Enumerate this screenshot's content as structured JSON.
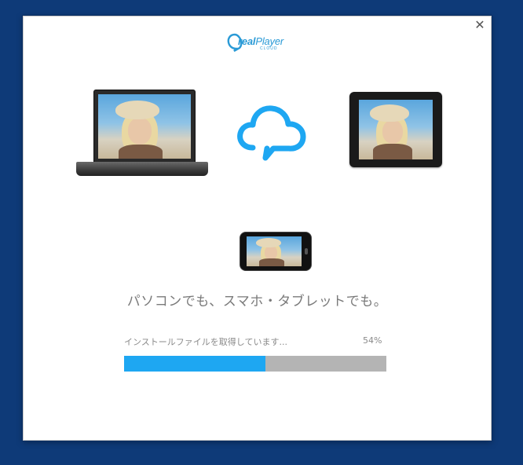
{
  "window": {
    "close_symbol": "✕"
  },
  "logo": {
    "brand_real": "real",
    "brand_player": "Player",
    "brand_sub": "CLOUD",
    "color": "#2a9ad6"
  },
  "illustration": {
    "devices": [
      "laptop",
      "cloud",
      "tablet",
      "phone"
    ],
    "cloud_color": "#1ea7f2"
  },
  "tagline": "パソコンでも、スマホ・タブレットでも。",
  "install": {
    "status": "インストールファイルを取得しています...",
    "percent_label": "54%",
    "progress": 0.54,
    "fill_color": "#1ea7f2",
    "track_color": "#b4b4b4"
  }
}
